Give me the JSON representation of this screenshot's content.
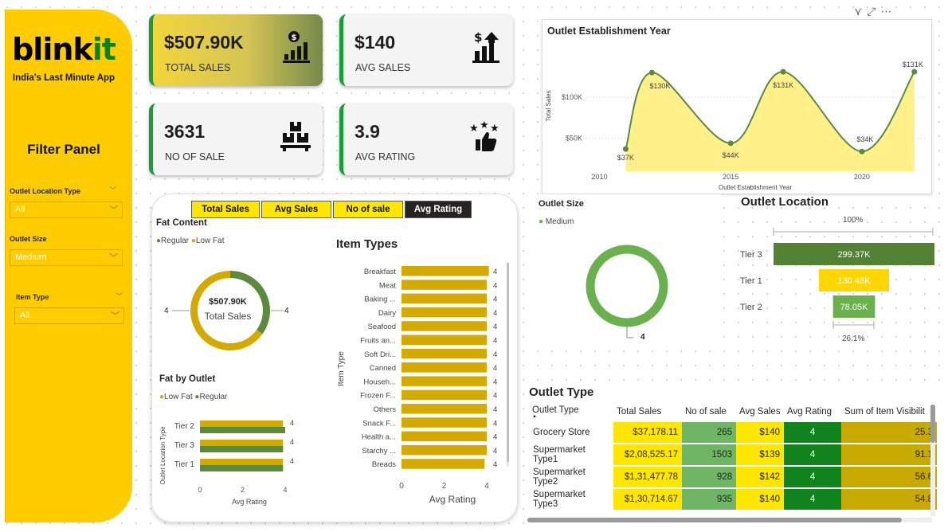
{
  "brand": {
    "logo_part1": "blink",
    "logo_part2": "it",
    "tagline": "India's Last Minute App"
  },
  "filter_panel": {
    "title": "Filter Panel",
    "filters": [
      {
        "label": "Outlet Location Type",
        "value": "All"
      },
      {
        "label": "Outlet Size",
        "value": "Medium"
      },
      {
        "label": "Item Type",
        "value": "All"
      }
    ]
  },
  "kpis": [
    {
      "value": "$507.90K",
      "label": "TOTAL SALES",
      "icon": "money-chart-icon"
    },
    {
      "value": "$140",
      "label": "AVG SALES",
      "icon": "growth-chart-icon"
    },
    {
      "value": "3631",
      "label": "NO OF SALE",
      "icon": "boxes-icon"
    },
    {
      "value": "3.9",
      "label": "AVG RATING",
      "icon": "rating-stars-icon"
    }
  ],
  "metric_buttons": [
    "Total Sales",
    "Avg Sales",
    "No of sale",
    "Avg Rating"
  ],
  "fat_content": {
    "title": "Fat Content",
    "legend": [
      "Regular",
      "Low Fat"
    ],
    "center_value": "$507.90K",
    "center_label": "Total Sales",
    "left_label": "4",
    "right_label": "4"
  },
  "fat_by_outlet": {
    "title": "Fat by Outlet",
    "legend": [
      "Low Fat",
      "Regular"
    ],
    "ylabel": "Outlet Location Type",
    "xlabel": "Avg Rating",
    "xticks": [
      "0",
      "2",
      "4"
    ],
    "rows": [
      {
        "tier": "Tier 2",
        "label": "4"
      },
      {
        "tier": "Tier 3",
        "label": "4"
      },
      {
        "tier": "Tier 1",
        "label": "4"
      }
    ]
  },
  "item_types": {
    "title": "Item Types",
    "ylabel": "Item Type",
    "xlabel": "Avg Rating",
    "xticks": [
      "0",
      "2",
      "4"
    ]
  },
  "outlet_size": {
    "title": "Outlet Size",
    "legend": "Medium",
    "value_label": "4"
  },
  "outlet_location": {
    "title": "Outlet Location",
    "top_label": "100%",
    "bottom_label": "26.1%",
    "rows": [
      {
        "tier": "Tier 3",
        "label": "299.37K"
      },
      {
        "tier": "Tier 1",
        "label": "130.48K"
      },
      {
        "tier": "Tier 2",
        "label": "78.05K"
      }
    ]
  },
  "visual_header_icons": [
    "filter-icon",
    "focus-mode-icon",
    "more-options-icon"
  ],
  "outlet_type_table": {
    "title": "Outlet Type",
    "columns": [
      "Outlet Type",
      "Total Sales",
      "No of sale",
      "Avg Sales",
      "Avg Rating",
      "Sum of Item Visibilit"
    ],
    "rows": [
      [
        "Grocery Store",
        "$37,178.11",
        "265",
        "$140",
        "4",
        "25.3"
      ],
      [
        "Supermarket Type1",
        "$2,08,525.17",
        "1503",
        "$139",
        "4",
        "91.1"
      ],
      [
        "Supermarket Type2",
        "$1,31,477.78",
        "928",
        "$142",
        "4",
        "56.6"
      ],
      [
        "Supermarket Type3",
        "$1,30,714.67",
        "935",
        "$140",
        "4",
        "54.8"
      ]
    ]
  },
  "chart_data": [
    {
      "type": "area",
      "title": "Outlet Establishment Year",
      "xlabel": "Outlet Establishment Year",
      "ylabel": "Total Sales",
      "xticks": [
        "2010",
        "2015",
        "2020"
      ],
      "yticks": [
        "$50K",
        "$100K"
      ],
      "x": [
        2011,
        2012,
        2015,
        2017,
        2020,
        2022
      ],
      "values": [
        37,
        130,
        44,
        131,
        34,
        131
      ],
      "point_labels": [
        "$37K",
        "$130K",
        "$44K",
        "$131K",
        "$34K",
        "$131K"
      ],
      "xlim": [
        2009.5,
        2022.4
      ],
      "ylim": [
        10,
        165
      ],
      "color": "#5c8a3c",
      "fill": "#fff08a"
    },
    {
      "type": "bar",
      "title": "Item Types",
      "categories": [
        "Breakfast",
        "Meat",
        "Baking ...",
        "Dairy",
        "Seafood",
        "Fruits an...",
        "Soft Dri...",
        "Canned",
        "Househ...",
        "Frozen F...",
        "Others",
        "Snack F...",
        "Health a...",
        "Starchy ...",
        "Breads"
      ],
      "values": [
        4.1,
        4.0,
        4.0,
        4.0,
        4.0,
        4.0,
        4.0,
        4.0,
        4.0,
        4.0,
        4.0,
        4.0,
        4.0,
        4.0,
        3.9
      ],
      "data_labels": [
        "4",
        "4",
        "4",
        "4",
        "4",
        "4",
        "4",
        "4",
        "4",
        "4",
        "4",
        "4",
        "4",
        "4",
        "4"
      ],
      "xlim": [
        0,
        4
      ],
      "color": "#d4aa00"
    },
    {
      "type": "bar",
      "title": "Fat by Outlet",
      "categories": [
        "Tier 2",
        "Tier 3",
        "Tier 1"
      ],
      "series": [
        {
          "name": "Low Fat",
          "values": [
            3.9,
            3.9,
            3.9
          ]
        },
        {
          "name": "Regular",
          "values": [
            4.0,
            3.9,
            3.9
          ]
        }
      ],
      "xlim": [
        0,
        4
      ]
    },
    {
      "type": "pie",
      "title": "Fat Content",
      "labels": [
        "Regular",
        "Low Fat"
      ],
      "values": [
        35,
        65
      ],
      "colors": [
        "#5c8a3c",
        "#d4aa00"
      ]
    },
    {
      "type": "bar",
      "title": "Outlet Location",
      "categories": [
        "Tier 3",
        "Tier 1",
        "Tier 2"
      ],
      "values": [
        299.37,
        130.48,
        78.05
      ],
      "colors": [
        "#548235",
        "#ffd700",
        "#6ab04c"
      ]
    }
  ]
}
